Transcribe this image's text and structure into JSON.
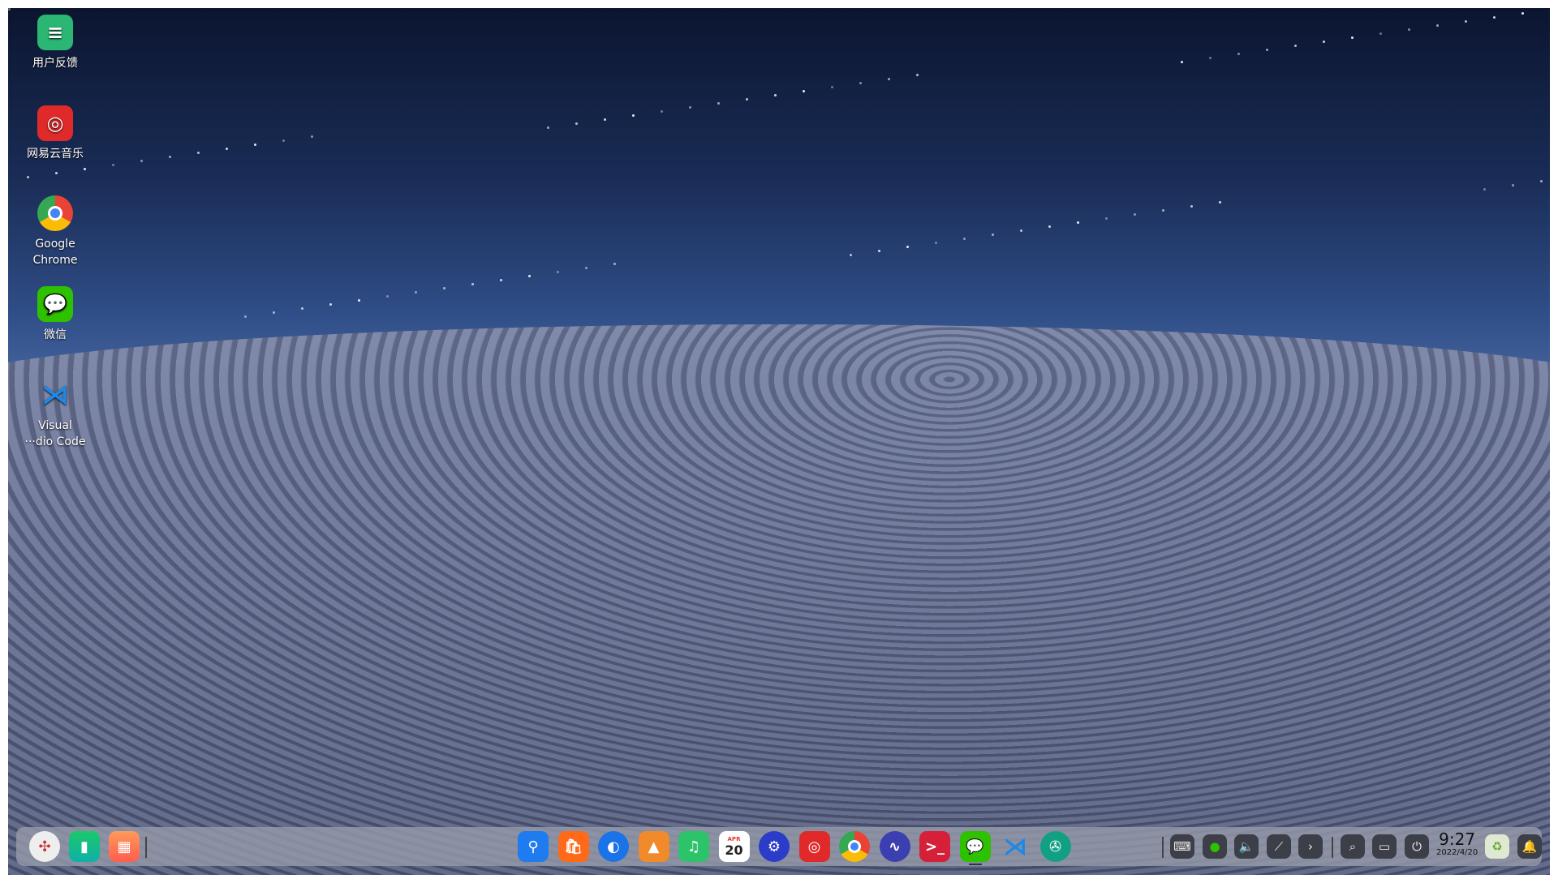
{
  "desktop": {
    "icons": [
      {
        "label": "用户反馈",
        "icon": "feedback-icon",
        "color": "#2bb673"
      },
      {
        "label": "网易云音乐",
        "icon": "netease-music-icon",
        "color": "#e02a2a"
      },
      {
        "label": "Google Chrome",
        "icon": "chrome-icon",
        "color": "#4285f4"
      },
      {
        "label": "微信",
        "icon": "wechat-icon",
        "color": "#2dc100"
      },
      {
        "label": "Visual ···dio Code",
        "icon": "vscode-icon",
        "color": "#1e88e5"
      }
    ]
  },
  "dock": {
    "left": [
      {
        "name": "launcher",
        "icon": "launcher-icon"
      },
      {
        "name": "show-desktop",
        "icon": "desktop-icon"
      },
      {
        "name": "multitask-view",
        "icon": "multitask-icon"
      }
    ],
    "apps": [
      {
        "name": "file-manager",
        "icon": "folder-icon",
        "color": "#1e7bf0"
      },
      {
        "name": "app-store",
        "icon": "store-icon",
        "color": "#ff6a1a"
      },
      {
        "name": "browser",
        "icon": "browser-icon",
        "color": "#1a73e8"
      },
      {
        "name": "image-viewer",
        "icon": "photo-icon",
        "color": "#f08a2a"
      },
      {
        "name": "music",
        "icon": "music-icon",
        "color": "#2cc36b"
      },
      {
        "name": "calendar",
        "icon": "calendar-icon",
        "color": "#ffffff",
        "month": "APR",
        "day": "20"
      },
      {
        "name": "control-center",
        "icon": "settings-icon",
        "color": "#2a3cc8"
      },
      {
        "name": "netease-music",
        "icon": "netease-music-icon",
        "color": "#e02a2a"
      },
      {
        "name": "google-chrome",
        "icon": "chrome-icon",
        "color": "#4285f4"
      },
      {
        "name": "system-monitor",
        "icon": "cpu-monitor-icon",
        "color": "#3b3fb0"
      },
      {
        "name": "terminal",
        "icon": "terminal-icon",
        "color": "#d6203a"
      },
      {
        "name": "wechat",
        "icon": "wechat-icon",
        "color": "#2dc100",
        "active": true
      },
      {
        "name": "vscode",
        "icon": "vscode-icon",
        "color": "#1e88e5"
      },
      {
        "name": "screenshot",
        "icon": "aperture-icon",
        "color": "#12a085"
      }
    ],
    "tray": [
      {
        "name": "keyboard",
        "icon": "keyboard-icon"
      },
      {
        "name": "wechat-tray",
        "icon": "wechat-icon"
      },
      {
        "name": "volume",
        "icon": "volume-icon"
      },
      {
        "name": "network",
        "icon": "network-icon"
      },
      {
        "name": "expand",
        "icon": "chevron-right-icon"
      }
    ],
    "system": [
      {
        "name": "search",
        "icon": "search-icon"
      },
      {
        "name": "onscreen-keyboard",
        "icon": "keyboard-icon"
      },
      {
        "name": "power",
        "icon": "power-icon"
      }
    ],
    "clock": {
      "time": "9:27",
      "date": "2022/4/20"
    },
    "trash": {
      "icon": "trash-icon"
    },
    "notifications": {
      "icon": "bell-icon"
    }
  }
}
